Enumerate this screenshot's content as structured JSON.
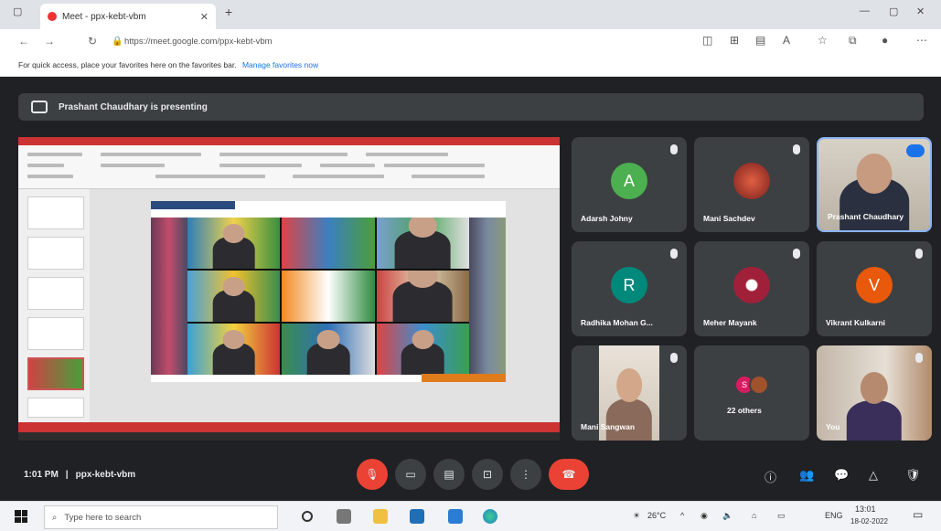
{
  "browser": {
    "tab_title": "Meet - ppx-kebt-vbm",
    "url": "https://meet.google.com/ppx-kebt-vbm",
    "favbar_text": "For quick access, place your favorites here on the favorites bar.",
    "favbar_link": "Manage favorites now"
  },
  "meet": {
    "presenting_text": "Prashant Chaudhary is presenting",
    "time": "1:01 PM",
    "meeting_code": "ppx-kebt-vbm",
    "tiles": [
      {
        "name": "Adarsh Johny",
        "initial": "A",
        "color": "#4caf50"
      },
      {
        "name": "Mani Sachdev"
      },
      {
        "name": "Prashant Chaudhary"
      },
      {
        "name": "Radhika Mohan G...",
        "initial": "R",
        "color": "#00897b"
      },
      {
        "name": "Meher Mayank"
      },
      {
        "name": "Vikrant Kulkarni",
        "initial": "V",
        "color": "#e8590c"
      },
      {
        "name": "Mani Sangwan"
      },
      {
        "name": "22 others",
        "initial": "S"
      },
      {
        "name": "You"
      }
    ]
  },
  "taskbar": {
    "search_placeholder": "Type here to search",
    "weather": "26°C",
    "lang": "ENG",
    "time": "13:01",
    "date": "18-02-2022"
  },
  "colors": {
    "meet_bg": "#202124",
    "tile_bg": "#3c4043",
    "hangup": "#ea4335",
    "accent": "#8ab4f8"
  }
}
